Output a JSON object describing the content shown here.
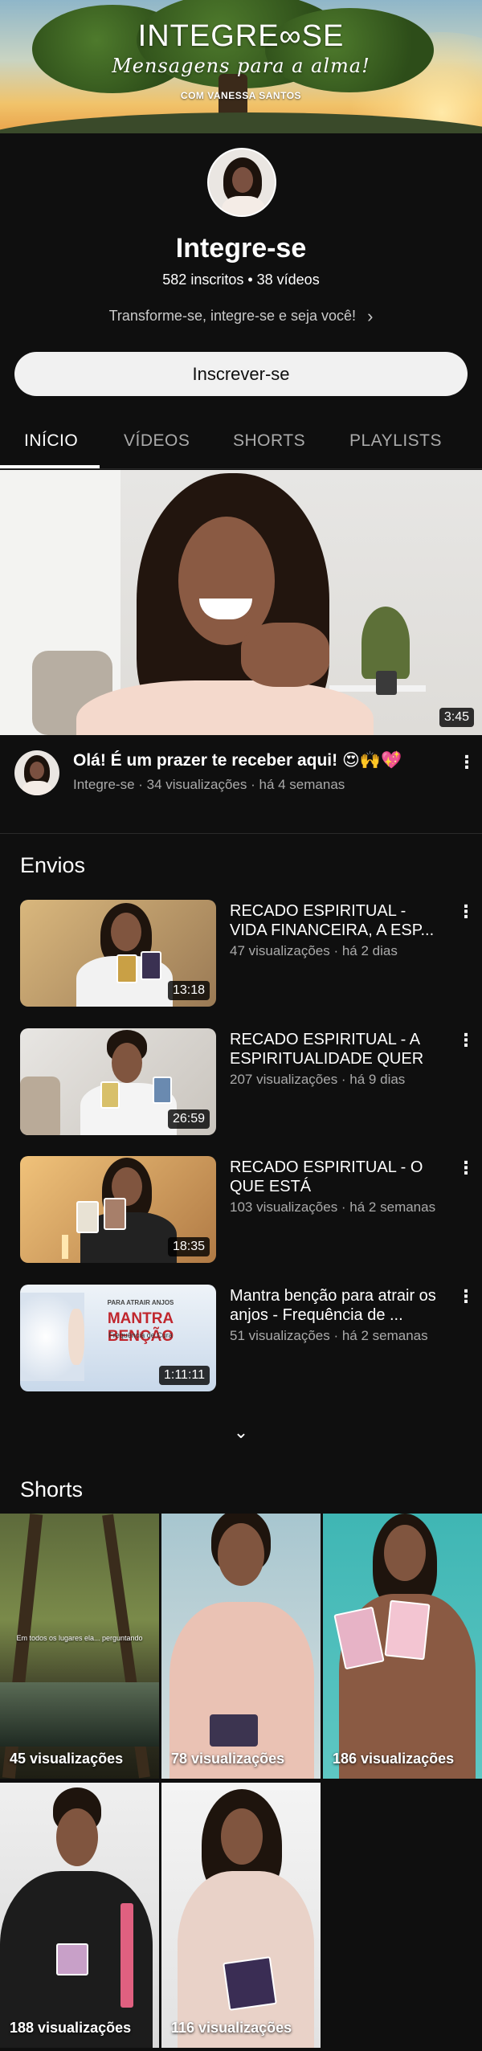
{
  "banner": {
    "brand": "INTEGRE∞SE",
    "tagline": "Mensagens para a alma!",
    "byline": "COM VANESSA SANTOS"
  },
  "channel": {
    "name": "Integre-se",
    "stats": "582 inscritos • 38 vídeos",
    "description": "Transforme-se, integre-se e seja você!",
    "subscribe_label": "Inscrever-se"
  },
  "tabs": [
    {
      "label": "INÍCIO",
      "active": true
    },
    {
      "label": "VÍDEOS",
      "active": false
    },
    {
      "label": "SHORTS",
      "active": false
    },
    {
      "label": "PLAYLISTS",
      "active": false
    }
  ],
  "featured": {
    "duration": "3:45",
    "title": "Olá! É um prazer te receber aqui! 😍🙌💖",
    "meta": "Integre-se · 34 visualizações · há 4 semanas"
  },
  "uploads": {
    "title": "Envios",
    "items": [
      {
        "title": "RECADO ESPIRITUAL - VIDA FINANCEIRA, A ESP...",
        "meta": "47 visualizações · há 2 dias",
        "duration": "13:18"
      },
      {
        "title": "RECADO ESPIRITUAL - A ESPIRITUALIDADE QUER F...",
        "meta": "207 visualizações · há 9 dias",
        "duration": "26:59"
      },
      {
        "title": "RECADO ESPIRITUAL - O QUE ESTÁ INTERFERINDO...",
        "meta": "103 visualizações · há 2 semanas",
        "duration": "18:35"
      },
      {
        "title": "Mantra benção para atrair os anjos - Frequência  de ...",
        "meta": "51 visualizações · há 2 semanas",
        "duration": "1:11:11",
        "thumb_text": {
          "small": "PARA ATRAIR ANJOS",
          "big": "MANTRA BENÇÃO",
          "sub": "Frequência de Cura"
        }
      }
    ]
  },
  "shorts": {
    "title": "Shorts",
    "items": [
      {
        "views": "45 visualizações",
        "caption": "Em todos os lugares ela... perguntando"
      },
      {
        "views": "78 visualizações"
      },
      {
        "views": "186 visualizações"
      },
      {
        "views": "188 visualizações"
      },
      {
        "views": "116 visualizações"
      }
    ]
  },
  "icons": [
    "chevron-right-icon",
    "more-vert-icon",
    "chevron-down-icon"
  ],
  "colors": {
    "background": "#0f0f0f",
    "text_secondary": "#aaaaaa",
    "button_bg": "#f1f1f1"
  }
}
